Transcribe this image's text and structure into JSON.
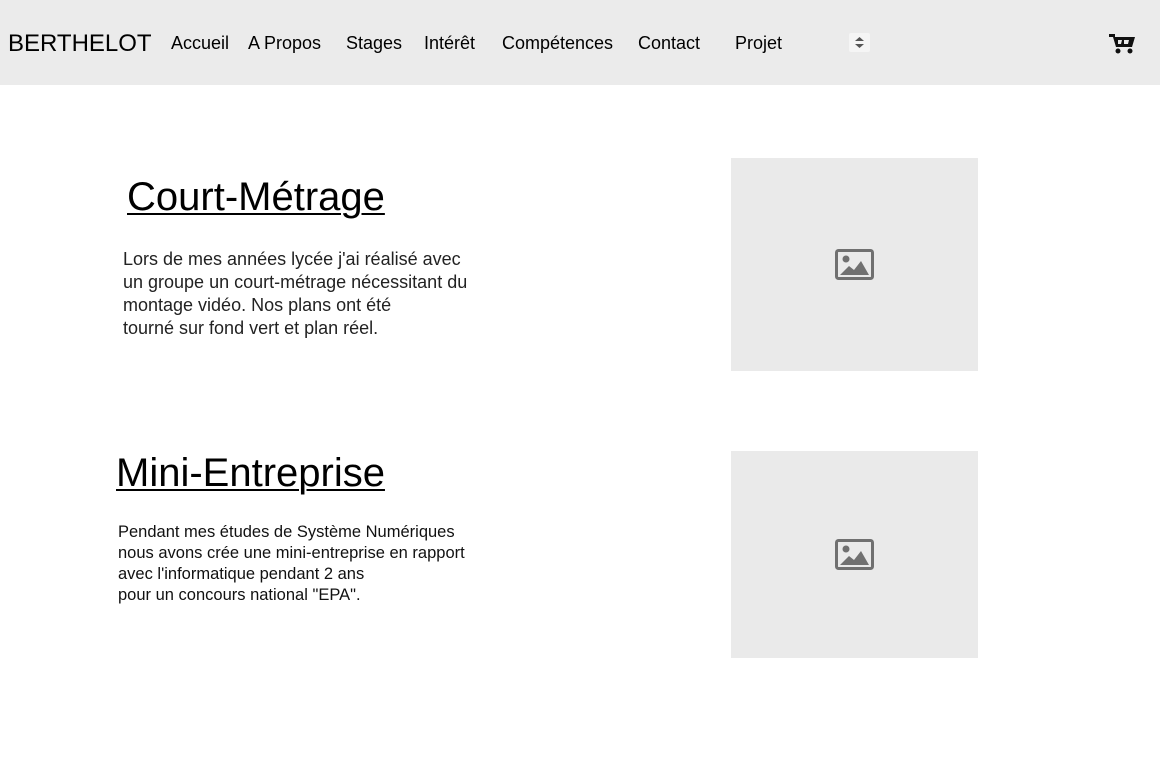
{
  "header": {
    "brand": "BERTHELOT",
    "nav": [
      {
        "label": "Accueil"
      },
      {
        "label": "A Propos"
      },
      {
        "label": "Stages"
      },
      {
        "label": "Intérêt"
      },
      {
        "label": "Compétences"
      },
      {
        "label": "Contact"
      },
      {
        "label": "Projet"
      }
    ],
    "select_icon": "updown-arrows-icon",
    "cart_icon": "cart-icon"
  },
  "sections": [
    {
      "title": "Court-Métrage",
      "text": "Lors de mes années lycée j'ai réalisé avec\nun groupe un court-métrage nécessitant du\nmontage vidéo. Nos plans ont été\ntourné sur fond vert et plan réel.",
      "image_icon": "image-placeholder-icon"
    },
    {
      "title": "Mini-Entreprise",
      "text": "Pendant mes études de Système Numériques\nnous avons crée une mini-entreprise en rapport\navec l'informatique pendant 2 ans\npour un concours national \"EPA\".",
      "image_icon": "image-placeholder-icon"
    }
  ],
  "colors": {
    "header_bg": "#ebebeb",
    "placeholder_bg": "#eaeaea",
    "placeholder_icon": "#707070"
  }
}
